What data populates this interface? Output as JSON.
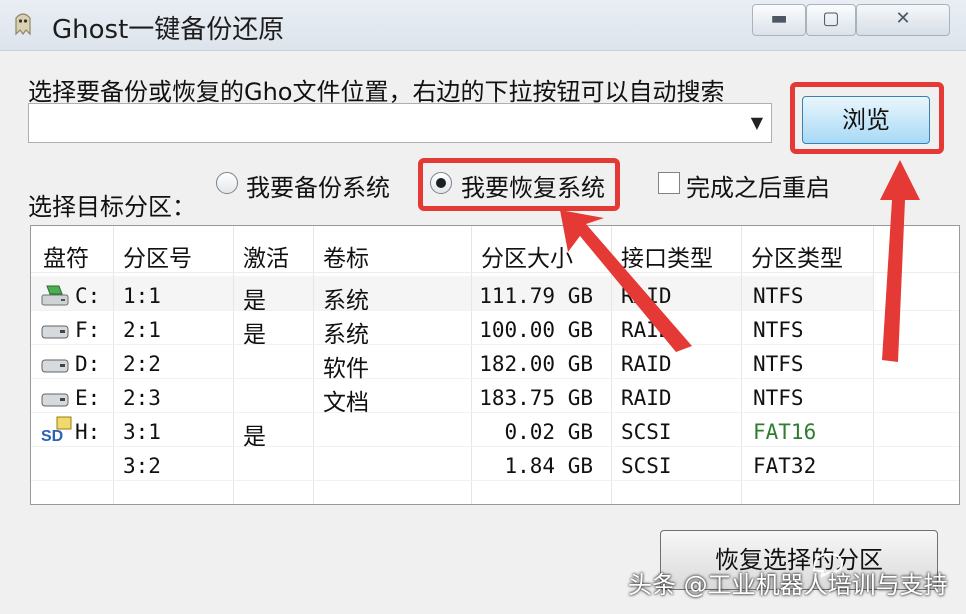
{
  "window": {
    "title": "Ghost一键备份还原",
    "min_glyph": "▬",
    "max_glyph": "▢",
    "close_glyph": "✕"
  },
  "path_section": {
    "label": "选择要备份或恢复的Gho文件位置，右边的下拉按钮可以自动搜索",
    "combo_value": "",
    "browse_label": "浏览"
  },
  "target_section": {
    "label": "选择目标分区：",
    "backup_option": "我要备份系统",
    "restore_option": "我要恢复系统",
    "selected": "restore",
    "reboot_option": "完成之后重启",
    "reboot_checked": false
  },
  "table": {
    "headers": [
      "盘符",
      "分区号",
      "激活",
      "卷标",
      "分区大小",
      "接口类型",
      "分区类型"
    ],
    "rows": [
      {
        "drive": "C:",
        "part": "1:1",
        "active": "是",
        "label": "系统",
        "size": "111.79 GB",
        "iface": "RAID",
        "fs": "NTFS",
        "icon": "system-drive-icon"
      },
      {
        "drive": "F:",
        "part": "2:1",
        "active": "是",
        "label": "系统",
        "size": "100.00 GB",
        "iface": "RAID",
        "fs": "NTFS",
        "icon": "hard-drive-icon"
      },
      {
        "drive": "D:",
        "part": "2:2",
        "active": "",
        "label": "软件",
        "size": "182.00 GB",
        "iface": "RAID",
        "fs": "NTFS",
        "icon": "hard-drive-icon"
      },
      {
        "drive": "E:",
        "part": "2:3",
        "active": "",
        "label": "文档",
        "size": "183.75 GB",
        "iface": "RAID",
        "fs": "NTFS",
        "icon": "hard-drive-icon"
      },
      {
        "drive": "H:",
        "part": "3:1",
        "active": "是",
        "label": "",
        "size": "0.02 GB",
        "iface": "SCSI",
        "fs": "FAT16",
        "icon": "sd-card-icon"
      },
      {
        "drive": "",
        "part": "3:2",
        "active": "",
        "label": "",
        "size": "1.84 GB",
        "iface": "SCSI",
        "fs": "FAT32",
        "icon": ""
      }
    ],
    "fat16_color": "#2e7d32"
  },
  "actions": {
    "restore_button": "恢复选择的分区"
  },
  "watermark": {
    "text": "头条 @工业机器人培训与支持"
  },
  "colors": {
    "highlight_red": "#e53935"
  }
}
